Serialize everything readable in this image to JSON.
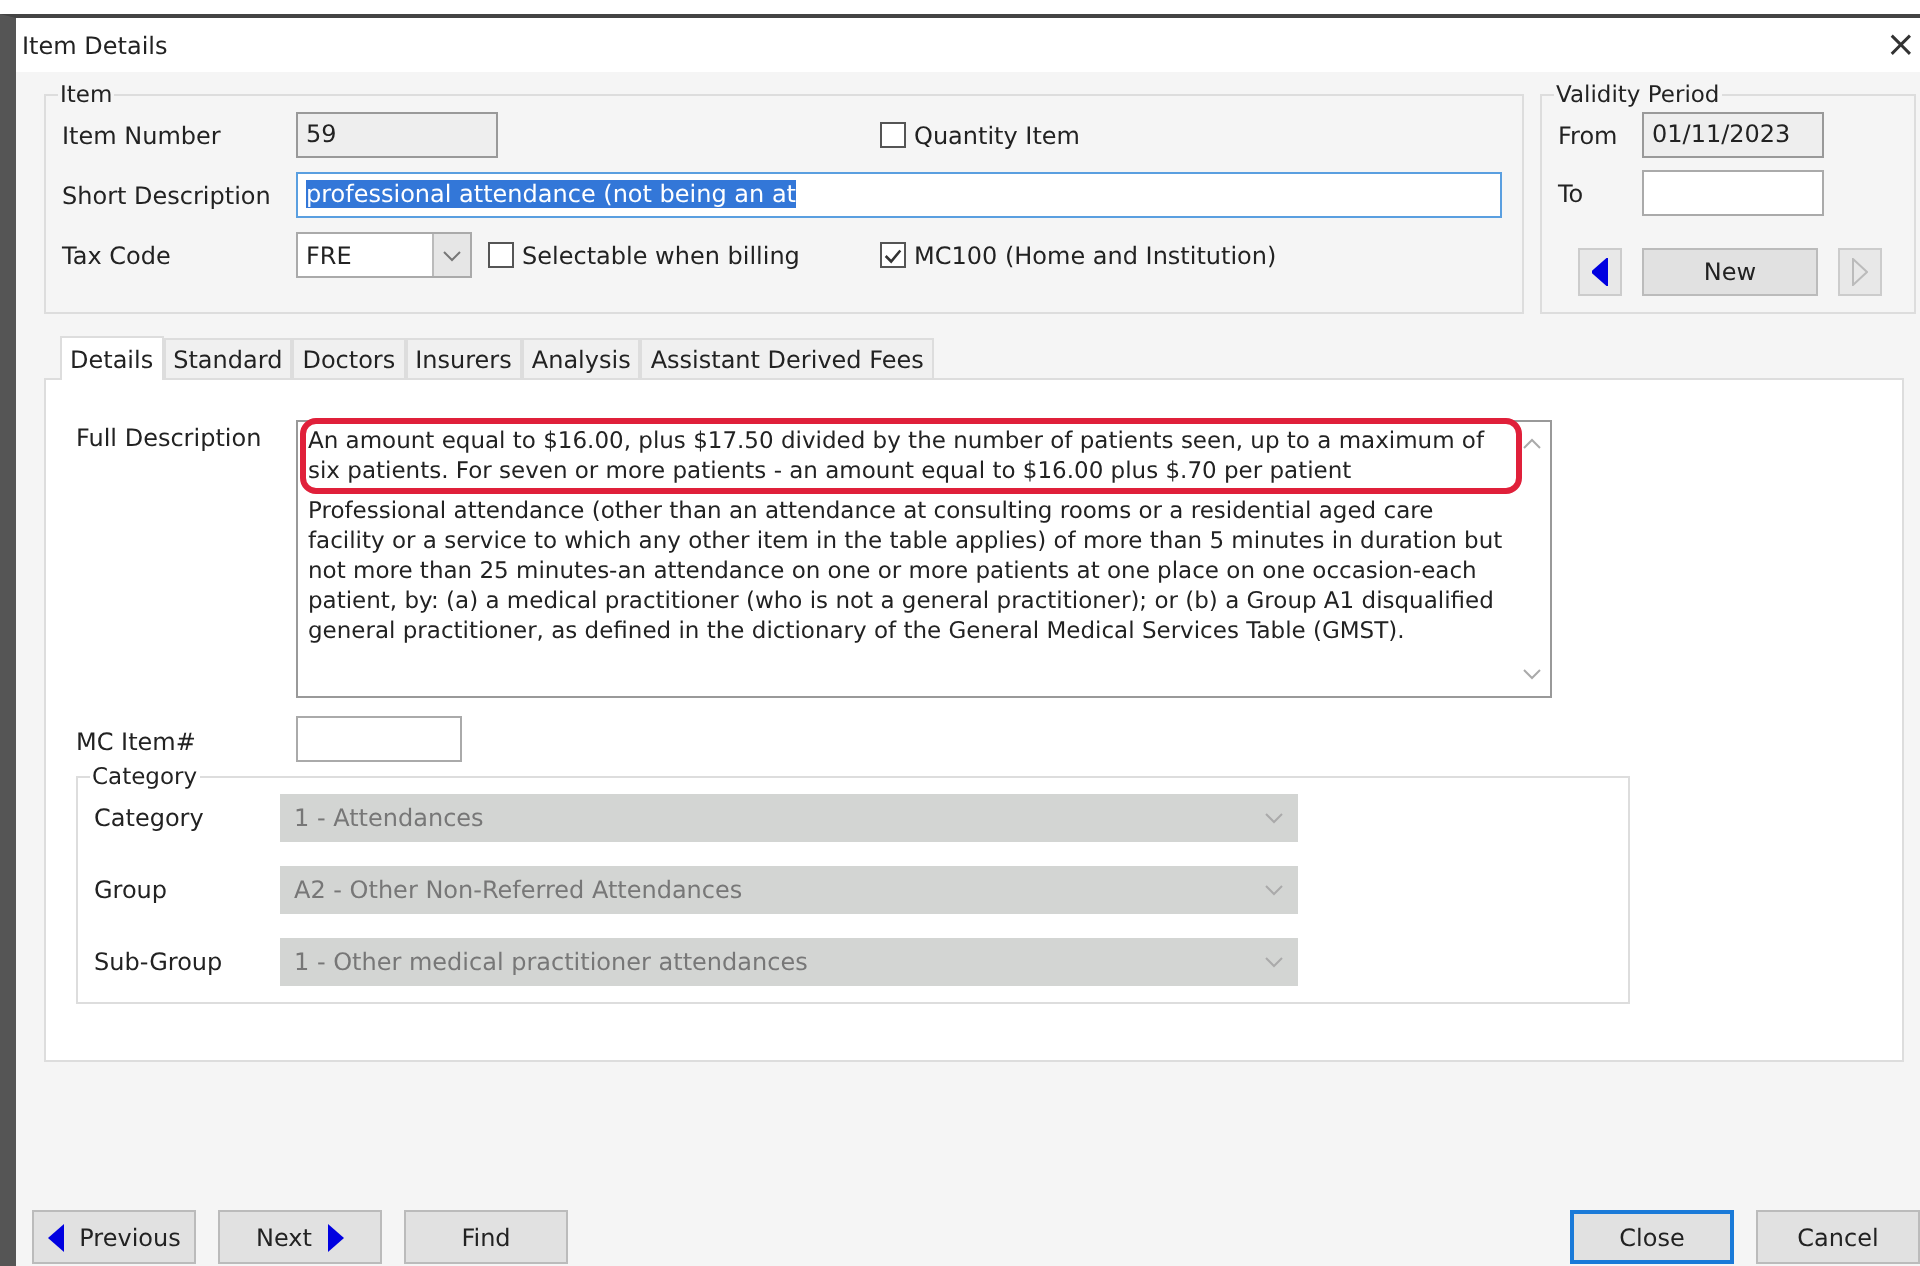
{
  "window": {
    "title": "Item Details",
    "close": "×"
  },
  "item": {
    "legend": "Item",
    "item_number": {
      "label": "Item Number",
      "value": "59",
      "disabled": true
    },
    "quantity_item": {
      "label": "Quantity Item",
      "checked": false
    },
    "short_description": {
      "label": "Short Description",
      "value": "professional attendance (not being an at",
      "selected": true
    },
    "tax_code": {
      "label": "Tax Code",
      "value": "FRE"
    },
    "selectable_when_billing": {
      "label": "Selectable when billing",
      "checked": false
    },
    "mc100": {
      "label": "MC100 (Home and Institution)",
      "checked": true
    }
  },
  "validity_period": {
    "legend": "Validity Period",
    "from": {
      "label": "From",
      "value": "01/11/2023"
    },
    "to": {
      "label": "To"
    },
    "previous_disabled": false,
    "new_button": "New",
    "next_disabled": true
  },
  "tabs": [
    {
      "label": "Details",
      "selected": true
    },
    {
      "label": "Standard",
      "selected": false
    },
    {
      "label": "Doctors",
      "selected": false
    },
    {
      "label": "Insurers",
      "selected": false
    },
    {
      "label": "Analysis",
      "selected": false
    },
    {
      "label": "Assistant Derived Fees",
      "selected": false
    }
  ],
  "full_description": {
    "label": "Full Description",
    "highlighted_text": "An amount equal to $16.00, plus $17.50 divided by the number of patients seen, up to a maximum of six patients. For seven or more patients - an amount equal to $16.00 plus $.70 per patient",
    "text": "Professional attendance (other than an attendance at consulting rooms or a residential aged care facility or a service to which any other item in the table applies) of more than 5 minutes in duration but not more than 25 minutes-an attendance on one or more patients at one place on one occasion-each patient, by: (a) a medical practitioner (who is not a general practitioner); or (b) a Group A1 disqualified general practitioner, as defined in the dictionary of the General Medical Services Table (GMST)."
  },
  "mc_item": {
    "label": "MC Item#"
  },
  "category_group": {
    "legend": "Category",
    "fields": [
      {
        "label": "Category",
        "value": "1 - Attendances",
        "disabled": true
      },
      {
        "label": "Group",
        "value": "A2 - Other Non-Referred Attendances",
        "disabled": true
      },
      {
        "label": "Sub-Group",
        "value": "1 - Other medical practitioner attendances",
        "disabled": true
      }
    ]
  },
  "buttons": [
    {
      "label": "Previous",
      "kind": "previous",
      "default": false
    },
    {
      "label": "Next",
      "kind": "next",
      "default": false
    },
    {
      "label": "Find",
      "kind": "plain",
      "default": false
    },
    {
      "label": "Close",
      "kind": "plain",
      "default": true
    },
    {
      "label": "Cancel",
      "kind": "plain",
      "default": false
    }
  ]
}
